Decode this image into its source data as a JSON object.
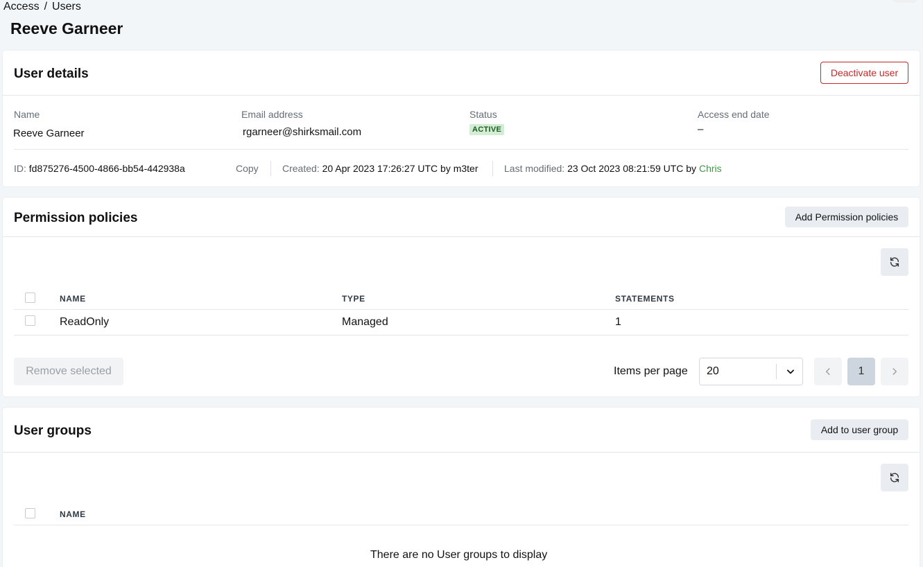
{
  "breadcrumb": {
    "parent": "Access",
    "separator": "/",
    "current": "Users"
  },
  "page_title": "Reeve Garneer",
  "user_details": {
    "title": "User details",
    "deactivate_label": "Deactivate user",
    "fields": {
      "name_label": "Name",
      "name_value": "Reeve Garneer",
      "email_label": "Email address",
      "email_value": "rgarneer@shirksmail.com",
      "status_label": "Status",
      "status_value": "ACTIVE",
      "end_label": "Access end date",
      "end_value": "–"
    },
    "meta": {
      "id_label": "ID:",
      "id_value": "fd875276-4500-4866-bb54-442938a",
      "copy_label": "Copy",
      "created_label": "Created:",
      "created_value": "20 Apr 2023 17:26:27 UTC by m3ter",
      "modified_label": "Last modified:",
      "modified_value": "23 Oct 2023 08:21:59 UTC by",
      "modified_by": "Chris"
    }
  },
  "permission_policies": {
    "title": "Permission policies",
    "add_label": "Add Permission policies",
    "columns": [
      "NAME",
      "TYPE",
      "STATEMENTS"
    ],
    "rows": [
      {
        "name": "ReadOnly",
        "type": "Managed",
        "statements": "1"
      }
    ],
    "remove_label": "Remove selected",
    "items_per_page_label": "Items per page",
    "items_per_page_value": "20",
    "current_page": "1"
  },
  "user_groups": {
    "title": "User groups",
    "add_label": "Add to user group",
    "columns": [
      "NAME"
    ],
    "empty_text": "There are no User groups to display"
  },
  "colors": {
    "accent_green": "#3b9b3f",
    "danger_red": "#c62828",
    "badge_bg": "#d3ecd4"
  },
  "icons": {
    "refresh": "refresh-icon",
    "chevron_down": "chevron-down-icon",
    "prev": "chevron-left-icon",
    "next": "chevron-right-icon"
  }
}
